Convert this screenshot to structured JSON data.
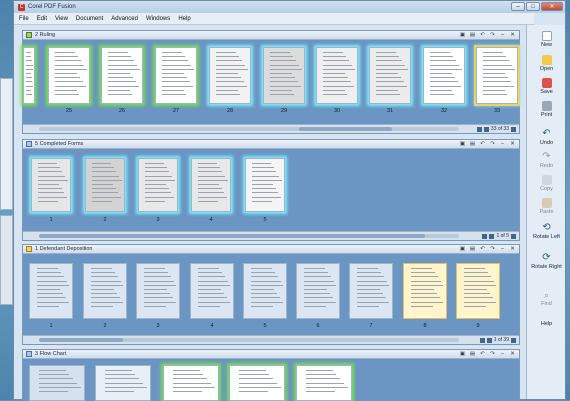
{
  "app": {
    "title": "Corel PDF Fusion"
  },
  "menu": [
    "File",
    "Edit",
    "View",
    "Document",
    "Advanced",
    "Windows",
    "Help"
  ],
  "window_controls": {
    "minimize": "–",
    "maximize": "□",
    "close": "✕"
  },
  "panels": [
    {
      "title": "2 Ruling",
      "labels": [
        "25",
        "26",
        "27",
        "28",
        "29",
        "30",
        "31",
        "32",
        "33"
      ],
      "page_status": "33 of 33"
    },
    {
      "title": "5 Completed Forms",
      "labels": [
        "1",
        "2",
        "3",
        "4",
        "5"
      ],
      "page_status": "1 of 5"
    },
    {
      "title": "1 Defendant Deposition",
      "labels": [
        "1",
        "2",
        "3",
        "4",
        "5",
        "6",
        "7",
        "8",
        "9"
      ],
      "page_status": "1 of 39"
    },
    {
      "title": "3 Flow Chart",
      "labels": [],
      "page_status": ""
    }
  ],
  "sidebar": [
    "New",
    "Open",
    "Save",
    "Print",
    "Undo",
    "Redo",
    "Copy",
    "Paste",
    "Rotate Left",
    "Rotate Right",
    "Find",
    "Help"
  ],
  "icons": {
    "app": "corel-logo-icon",
    "doc": "document-icon"
  }
}
